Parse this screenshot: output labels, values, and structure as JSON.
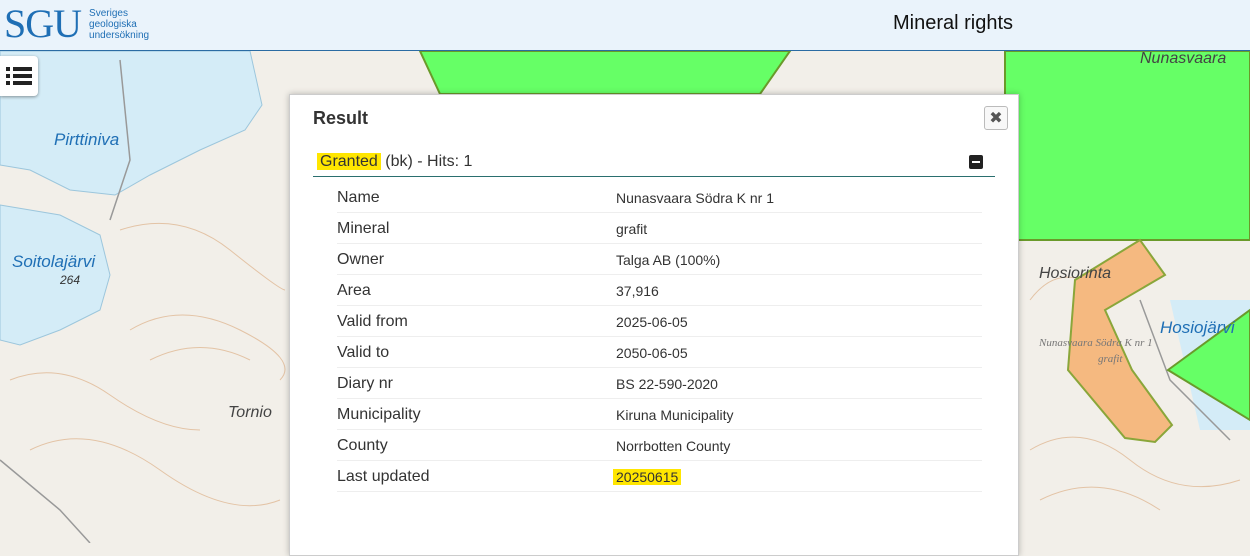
{
  "header": {
    "logo_mark": "SGU",
    "logo_lines": [
      "Sveriges",
      "geologiska",
      "undersökning"
    ],
    "title": "Mineral rights"
  },
  "map": {
    "labels": {
      "pirttiniva": "Pirttiniva",
      "soitolajarvi": "Soitolajärvi",
      "lake_elevation": "264",
      "tornio": "Tornio",
      "nunasvaara": "Nunasvaara",
      "hosiorinta": "Hosiorinta",
      "hosiojarvi": "Hosiojärvi",
      "claim_name": "Nunasvaara Södra K nr 1",
      "claim_mineral": "grafit"
    },
    "colors": {
      "granted": "#66ff66",
      "claim": "#f5b980",
      "water": "#d4ecf7"
    }
  },
  "toolbar": {
    "layers_icon": "list-icon"
  },
  "result": {
    "title": "Result",
    "close_icon": "close-icon",
    "section": {
      "status": "Granted",
      "suffix": " (bk) - Hits: 1"
    },
    "rows": [
      {
        "key": "Name",
        "value": "Nunasvaara Södra K nr 1"
      },
      {
        "key": "Mineral",
        "value": "grafit"
      },
      {
        "key": "Owner",
        "value": "Talga AB (100%)"
      },
      {
        "key": "Area",
        "value": "37,916"
      },
      {
        "key": "Valid from",
        "value": "2025-06-05"
      },
      {
        "key": "Valid to",
        "value": "2050-06-05"
      },
      {
        "key": "Diary nr",
        "value": "BS 22-590-2020"
      },
      {
        "key": "Municipality",
        "value": "Kiruna Municipality"
      },
      {
        "key": "County",
        "value": "Norrbotten County"
      },
      {
        "key": "Last updated",
        "value": "20250615"
      }
    ]
  }
}
